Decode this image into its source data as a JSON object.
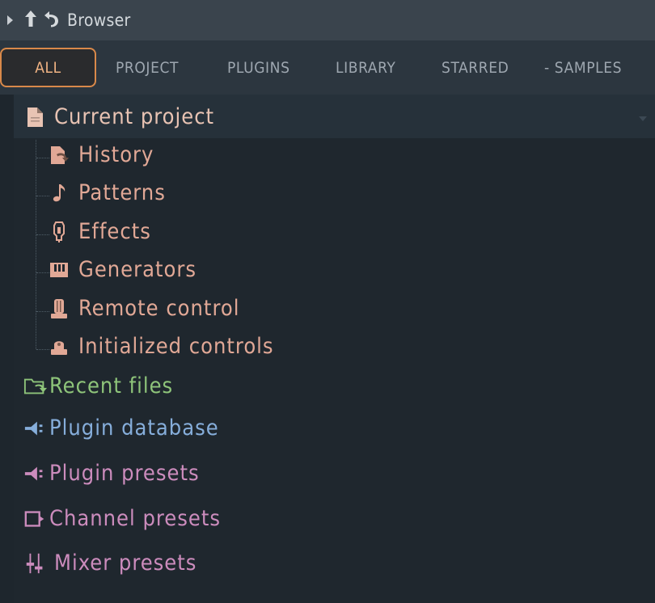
{
  "titlebar": {
    "title": "Browser"
  },
  "tabs": [
    {
      "label": "ALL",
      "active": true
    },
    {
      "label": "PROJECT"
    },
    {
      "label": "PLUGINS"
    },
    {
      "label": "LIBRARY"
    },
    {
      "label": "STARRED"
    },
    {
      "label": "- SAMPLES"
    }
  ],
  "tree": {
    "current_project": {
      "label": "Current project",
      "icon": "document-icon",
      "children": [
        {
          "label": "History",
          "icon": "history-icon"
        },
        {
          "label": "Patterns",
          "icon": "note-icon"
        },
        {
          "label": "Effects",
          "icon": "effects-icon"
        },
        {
          "label": "Generators",
          "icon": "piano-icon"
        },
        {
          "label": "Remote control",
          "icon": "remote-knob-icon"
        },
        {
          "label": "Initialized controls",
          "icon": "init-knob-icon"
        }
      ]
    },
    "folders": [
      {
        "label": "Recent files",
        "icon": "recent-folder-icon",
        "color": "#8ec47a"
      },
      {
        "label": "Plugin database",
        "icon": "plug-icon",
        "color": "#86aedb"
      },
      {
        "label": "Plugin presets",
        "icon": "plug-icon",
        "color": "#cc8cbd"
      },
      {
        "label": "Channel presets",
        "icon": "channel-icon",
        "color": "#cc8cbd"
      },
      {
        "label": "Mixer presets",
        "icon": "mixer-icon",
        "color": "#cc8cbd"
      }
    ]
  },
  "colors": {
    "accent": "#d9894a",
    "project_text": "#e8c3b3",
    "subitem_text": "#e1a896"
  }
}
